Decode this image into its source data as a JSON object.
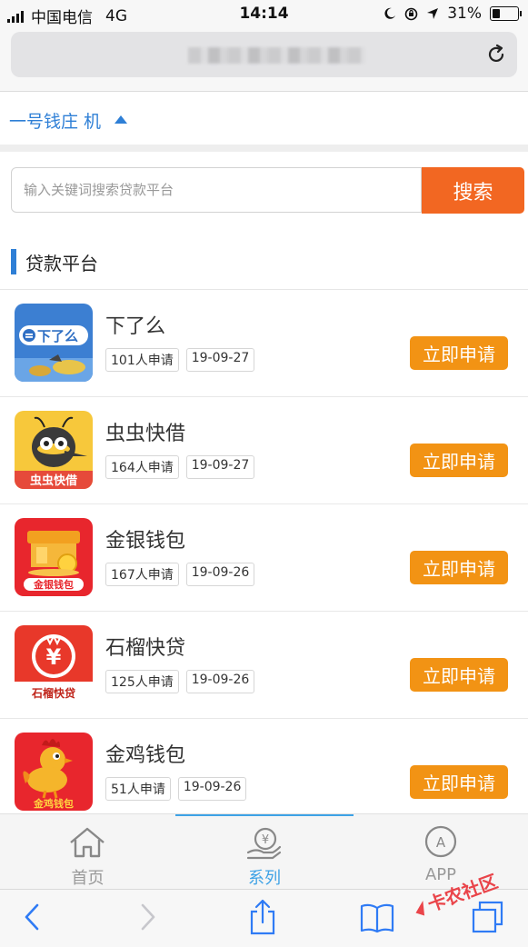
{
  "status_bar": {
    "carrier": "中国电信",
    "network": "4G",
    "time": "14:14",
    "battery": "31%",
    "battery_level": 0.31
  },
  "browser": {
    "reload_icon": "reload-icon"
  },
  "category": {
    "title": "一号钱庄 机"
  },
  "search": {
    "placeholder": "输入关键词搜索贷款平台",
    "button_label": "搜索"
  },
  "section": {
    "title": "贷款平台"
  },
  "platforms": [
    {
      "name": "下了么",
      "applicants": "101人申请",
      "date": "19-09-27",
      "button": "立即申请",
      "logo_text": "下了么"
    },
    {
      "name": "虫虫快借",
      "applicants": "164人申请",
      "date": "19-09-27",
      "button": "立即申请",
      "logo_text": "虫虫快借"
    },
    {
      "name": "金银钱包",
      "applicants": "167人申请",
      "date": "19-09-26",
      "button": "立即申请",
      "logo_text": "金银钱包"
    },
    {
      "name": "石榴快贷",
      "applicants": "125人申请",
      "date": "19-09-26",
      "button": "立即申请",
      "logo_text": "石榴快贷"
    },
    {
      "name": "金鸡钱包",
      "applicants": "51人申请",
      "date": "19-09-26",
      "button": "立即申请",
      "logo_text": "金鸡钱包"
    }
  ],
  "tabbar": {
    "home": "首页",
    "series": "系列",
    "app": "APP"
  },
  "watermark": "卡农社区",
  "colors": {
    "accent_blue": "#2e7fd6",
    "search_orange": "#f26722",
    "apply_orange": "#f29314",
    "tab_active": "#3ea2e6"
  }
}
